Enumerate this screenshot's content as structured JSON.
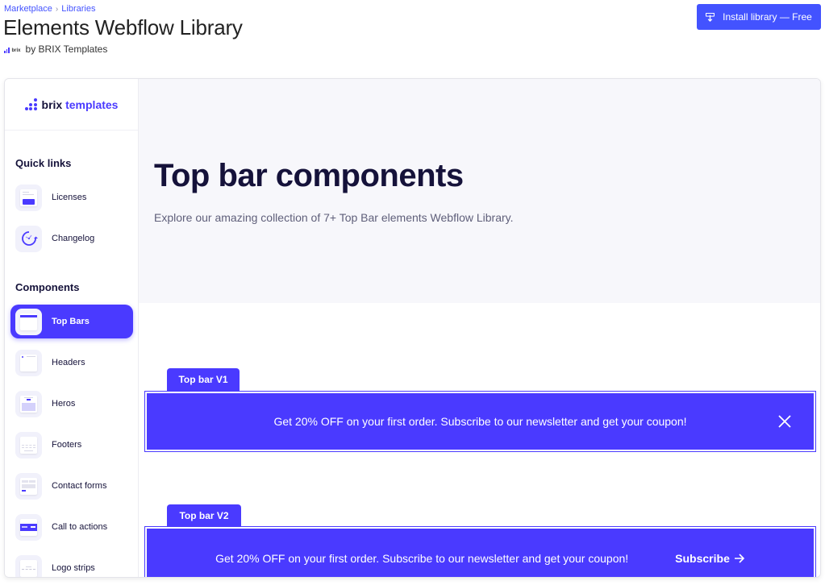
{
  "breadcrumb": {
    "items": [
      "Marketplace",
      "Libraries"
    ],
    "separator": "›"
  },
  "page": {
    "title": "Elements Webflow Library",
    "author": "by BRIX Templates",
    "author_logo_text": "brix"
  },
  "install_button": {
    "label": "Install library — Free",
    "icon": "download-icon"
  },
  "sidebar": {
    "brand": {
      "text_main": "brix",
      "text_accent": "templates"
    },
    "quick_links_title": "Quick links",
    "quick_links": [
      {
        "label": "Licenses",
        "icon": "license-icon"
      },
      {
        "label": "Changelog",
        "icon": "changelog-icon"
      }
    ],
    "components_title": "Components",
    "components": [
      {
        "label": "Top Bars",
        "icon": "top-bar-icon",
        "active": true
      },
      {
        "label": "Headers",
        "icon": "header-icon",
        "active": false
      },
      {
        "label": "Heros",
        "icon": "hero-icon",
        "active": false
      },
      {
        "label": "Footers",
        "icon": "footer-icon",
        "active": false
      },
      {
        "label": "Contact forms",
        "icon": "contact-form-icon",
        "active": false
      },
      {
        "label": "Call to actions",
        "icon": "cta-icon",
        "active": false
      },
      {
        "label": "Logo strips",
        "icon": "logo-strip-icon",
        "active": false
      }
    ]
  },
  "hero": {
    "title": "Top bar components",
    "subtitle": "Explore our amazing collection of 7+ Top Bar elements Webflow Library."
  },
  "previews": [
    {
      "tab": "Top bar V1",
      "message": "Get 20% OFF on your first order. Subscribe to our newsletter and get your coupon!",
      "action": "close"
    },
    {
      "tab": "Top bar V2",
      "message": "Get 20% OFF on your first order. Subscribe to our newsletter and get your coupon!",
      "action_label": "Subscribe"
    }
  ],
  "colors": {
    "accent": "#4a3aff",
    "link": "#4353ff",
    "heading": "#15123a",
    "hero_bg": "#f7f7fb"
  }
}
